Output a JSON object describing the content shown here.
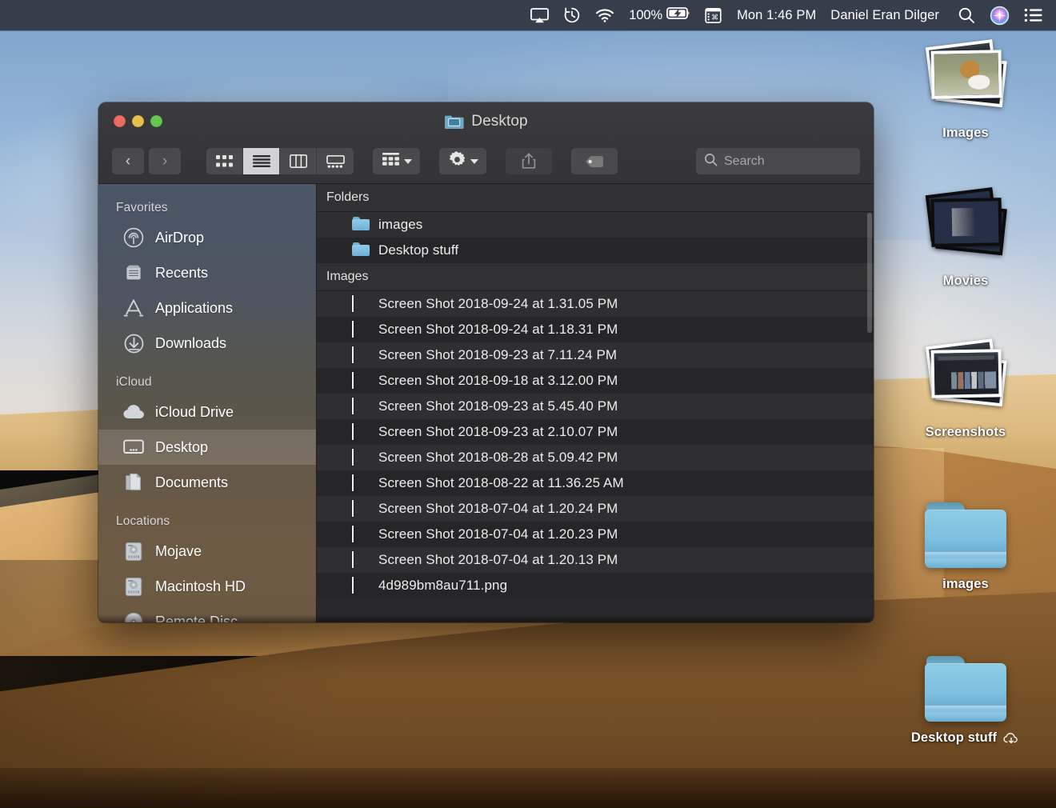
{
  "menubar": {
    "icons": [
      "airplay-icon",
      "time-machine-icon",
      "wifi-icon",
      "battery-icon",
      "input-source-icon",
      "spotlight-icon",
      "siri-icon",
      "control-center-icon"
    ],
    "battery_percent": "100%",
    "clock": "Mon 1:46 PM",
    "user": "Daniel Eran Dilger"
  },
  "desktop": {
    "icons": [
      {
        "label": "Images",
        "type": "stack-photos"
      },
      {
        "label": "Movies",
        "type": "stack-movies"
      },
      {
        "label": "Screenshots",
        "type": "stack-screenshots"
      },
      {
        "label": "images",
        "type": "folder"
      },
      {
        "label": "Desktop stuff",
        "type": "folder",
        "badge": "icloud-download-icon"
      }
    ]
  },
  "finder": {
    "title": "Desktop",
    "title_icon": "desktop-folder-icon",
    "traffic_lights": {
      "close": "close-button",
      "minimize": "minimize-button",
      "zoom": "zoom-button",
      "close_color": "#ec6a5e",
      "minimize_color": "#e3c14c",
      "zoom_color": "#62c554"
    },
    "toolbar": {
      "back": "‹",
      "forward": "›",
      "view_modes": [
        {
          "name": "icon-view",
          "active": false
        },
        {
          "name": "list-view",
          "active": true
        },
        {
          "name": "column-view",
          "active": false
        },
        {
          "name": "gallery-view",
          "active": false
        }
      ],
      "group_by": "group-by-button",
      "action": "action-gear-button",
      "share": "share-button",
      "tags": "tags-button",
      "search_placeholder": "Search",
      "search_value": ""
    },
    "sidebar": {
      "sections": [
        {
          "title": "Favorites",
          "items": [
            {
              "label": "AirDrop",
              "icon": "airdrop-icon",
              "selected": false
            },
            {
              "label": "Recents",
              "icon": "recents-icon",
              "selected": false
            },
            {
              "label": "Applications",
              "icon": "applications-icon",
              "selected": false
            },
            {
              "label": "Downloads",
              "icon": "downloads-icon",
              "selected": false
            }
          ]
        },
        {
          "title": "iCloud",
          "items": [
            {
              "label": "iCloud Drive",
              "icon": "icloud-icon",
              "selected": false
            },
            {
              "label": "Desktop",
              "icon": "desktop-icon",
              "selected": true
            },
            {
              "label": "Documents",
              "icon": "documents-icon",
              "selected": false
            }
          ]
        },
        {
          "title": "Locations",
          "items": [
            {
              "label": "Mojave",
              "icon": "hard-drive-icon",
              "selected": false
            },
            {
              "label": "Macintosh HD",
              "icon": "hard-drive-icon",
              "selected": false
            },
            {
              "label": "Remote Disc",
              "icon": "disc-icon",
              "selected": false
            }
          ]
        }
      ]
    },
    "content": {
      "groups": [
        {
          "header": "Folders",
          "rows": [
            {
              "name": "images",
              "icon": "folder-icon"
            },
            {
              "name": "Desktop stuff",
              "icon": "folder-icon"
            }
          ]
        },
        {
          "header": "Images",
          "rows": [
            {
              "name": "Screen Shot 2018-09-24 at 1.31.05 PM",
              "icon": "image-thumb-dark"
            },
            {
              "name": "Screen Shot 2018-09-24 at 1.18.31 PM",
              "icon": "image-thumb-red"
            },
            {
              "name": "Screen Shot 2018-09-23 at 7.11.24 PM",
              "icon": "image-thumb-tall"
            },
            {
              "name": "Screen Shot 2018-09-18 at 3.12.00 PM",
              "icon": "image-thumb-window"
            },
            {
              "name": "Screen Shot 2018-09-23 at 5.45.40 PM",
              "icon": "image-thumb-dark2"
            },
            {
              "name": "Screen Shot 2018-09-23 at 2.10.07 PM",
              "icon": "image-thumb-wide"
            },
            {
              "name": "Screen Shot 2018-08-28 at 5.09.42 PM",
              "icon": "image-thumb-doc"
            },
            {
              "name": "Screen Shot 2018-08-22 at 11.36.25 AM",
              "icon": "image-thumb-lines"
            },
            {
              "name": "Screen Shot 2018-07-04 at 1.20.24 PM",
              "icon": "image-thumb-panel"
            },
            {
              "name": "Screen Shot 2018-07-04 at 1.20.23 PM",
              "icon": "image-thumb-panel"
            },
            {
              "name": "Screen Shot 2018-07-04 at 1.20.13 PM",
              "icon": "image-thumb-wide"
            },
            {
              "name": "4d989bm8au711.png",
              "icon": "image-thumb-photo"
            }
          ]
        }
      ]
    }
  }
}
